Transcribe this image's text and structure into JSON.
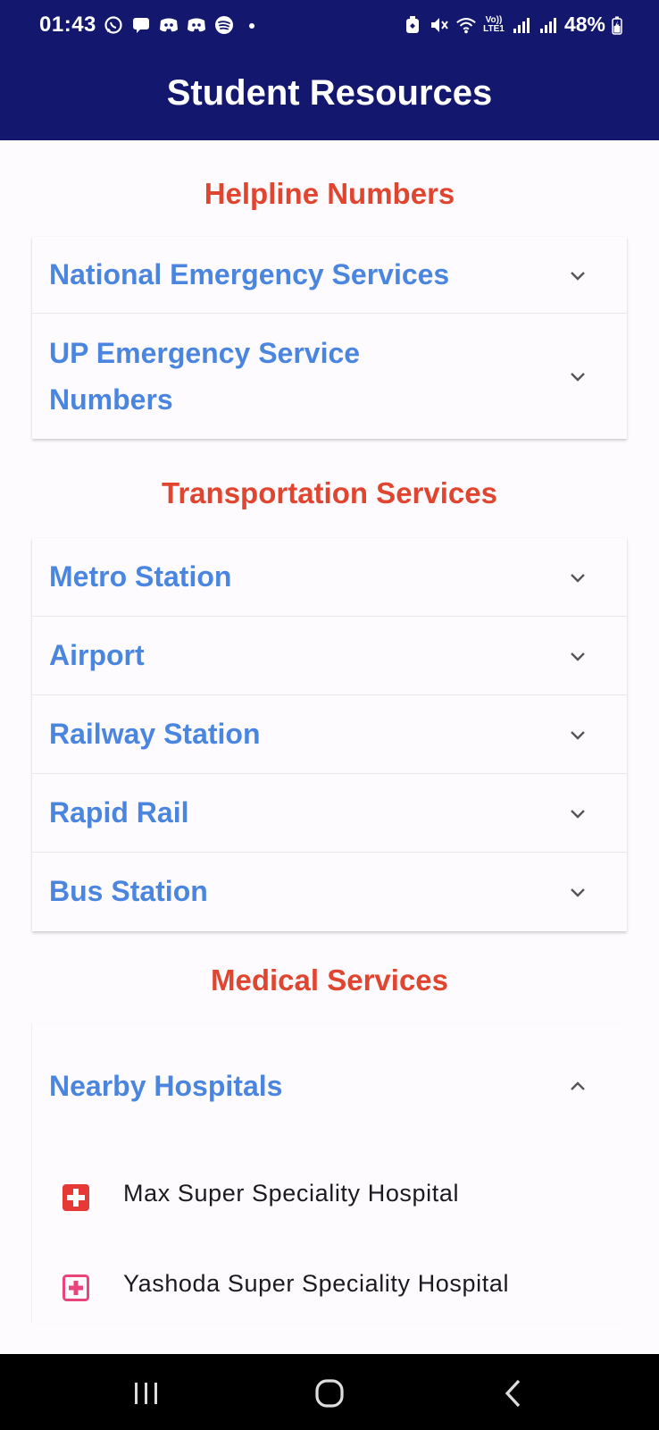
{
  "status_bar": {
    "time": "01:43",
    "left_icons": [
      "whatsapp-icon",
      "message-icon",
      "discord-icon",
      "discord-icon",
      "spotify-icon",
      "dot-icon"
    ],
    "right_icons": [
      "battery-saver-icon",
      "mute-icon",
      "wifi-icon",
      "volte-icon",
      "signal-icon",
      "signal-icon"
    ],
    "battery": "48%",
    "network_label": "Vo)) LTE1"
  },
  "app_bar": {
    "title": "Student Resources",
    "background": "#13176e"
  },
  "sections": {
    "helpline": {
      "title": "Helpline Numbers",
      "items": [
        "National Emergency Services",
        "UP Emergency Service Numbers"
      ]
    },
    "transport": {
      "title": "Transportation Services",
      "items": [
        "Metro Station",
        "Airport",
        "Railway Station",
        "Rapid Rail",
        "Bus Station"
      ]
    },
    "medical": {
      "title": "Medical Services",
      "items": [
        "Nearby Hospitals"
      ],
      "expanded_item": "Nearby Hospitals",
      "hospitals": [
        {
          "name": "Max Super Speciality Hospital",
          "icon": "hospital-filled-icon",
          "color": "#e53935"
        },
        {
          "name": "Yashoda Super Speciality Hospital",
          "icon": "hospital-outline-icon",
          "color": "#e8457a"
        }
      ]
    }
  },
  "colors": {
    "section_title": "#e04530",
    "item_label": "#4a86e0",
    "chevron": "#555555"
  },
  "nav_bar": {
    "buttons": [
      "recent-apps-icon",
      "home-icon",
      "back-icon"
    ]
  }
}
